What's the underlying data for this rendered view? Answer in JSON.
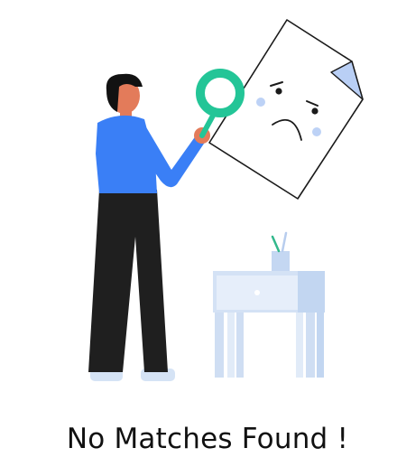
{
  "empty_state": {
    "message": "No Matches Found !"
  },
  "illustration": {
    "colors": {
      "shirt": "#3a7ff6",
      "pants": "#1f1f1f",
      "hair": "#121212",
      "skin": "#e37b5a",
      "magnifier": "#23c597",
      "paper_outline": "#1a1a1a",
      "paper_fold": "#b9cff5",
      "cheek": "#bdd2f6",
      "table": "#c9daf3",
      "table_shadow": "#dce8f8",
      "shoes": "#d5e3f5",
      "pencil_green": "#33b88c"
    }
  }
}
